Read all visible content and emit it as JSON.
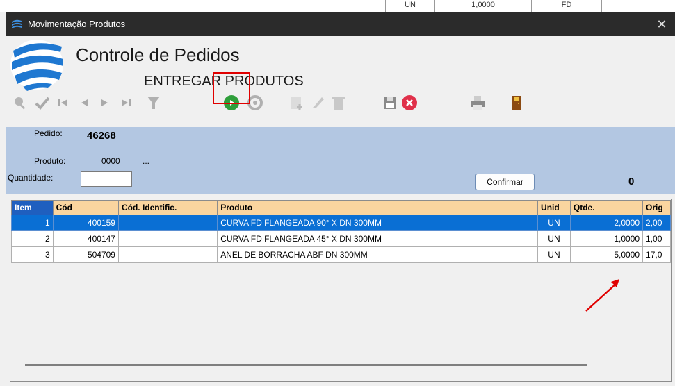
{
  "background": {
    "cells": [
      "UN",
      "1,0000",
      "FD"
    ]
  },
  "window": {
    "title": "Movimentação Produtos",
    "close_label": "✕"
  },
  "header": {
    "title": "Controle de Pedidos",
    "subtitle": "ENTREGAR PRODUTOS"
  },
  "toolbar": {
    "icons": [
      "search-icon",
      "check-icon",
      "first-icon",
      "prev-icon",
      "next-icon",
      "last-icon",
      "filter-icon",
      "play-icon",
      "refresh-icon",
      "add-icon",
      "edit-icon",
      "delete-icon",
      "save-icon",
      "cancel-icon",
      "print-icon",
      "exit-door-icon"
    ]
  },
  "form": {
    "pedido_label": "Pedido:",
    "pedido_value": "46268",
    "produto_label": "Produto:",
    "produto_value": "0000",
    "produto_desc": "...",
    "quantidade_label": "Quantidade:",
    "quantidade_value": "",
    "confirm_label": "Confirmar",
    "count": "0"
  },
  "grid": {
    "columns": [
      "Item",
      "Cód",
      "Cód. Identific.",
      "Produto",
      "Unid",
      "Qtde.",
      "Orig"
    ],
    "rows": [
      {
        "item": "1",
        "cod": "400159",
        "cod_ident": "",
        "produto": "CURVA FD FLANGEADA 90° X DN 300MM",
        "unid": "UN",
        "qtde": "2,0000",
        "orig": "2,00"
      },
      {
        "item": "2",
        "cod": "400147",
        "cod_ident": "",
        "produto": "CURVA FD FLANGEADA 45° X DN 300MM",
        "unid": "UN",
        "qtde": "1,0000",
        "orig": "1,00"
      },
      {
        "item": "3",
        "cod": "504709",
        "cod_ident": "",
        "produto": "ANEL DE BORRACHA ABF DN 300MM",
        "unid": "UN",
        "qtde": "5,0000",
        "orig": "17,0"
      }
    ],
    "selected_row": 0
  },
  "colors": {
    "titlebar": "#2b2b2b",
    "form_panel": "#b3c7e2",
    "header_cell": "#fad59f",
    "selection": "#0a6fd4",
    "highlight": "#e00000"
  }
}
